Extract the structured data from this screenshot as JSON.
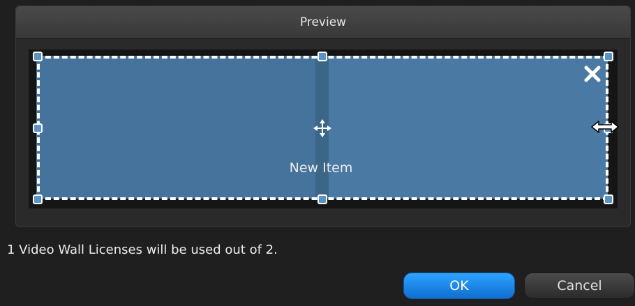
{
  "dialog": {
    "preview_title": "Preview",
    "item_label": "New Item",
    "license_message": "1 Video Wall Licenses will be used out of 2.",
    "ok_label": "OK",
    "cancel_label": "Cancel"
  },
  "icons": {
    "close": "close-icon",
    "move": "move-icon",
    "resize": "horizontal-resize-cursor-icon",
    "handle": "resize-handle"
  },
  "colors": {
    "tile_fill": "#46739b",
    "ok_button": "#1e88e5",
    "background": "#1f1f1f"
  }
}
